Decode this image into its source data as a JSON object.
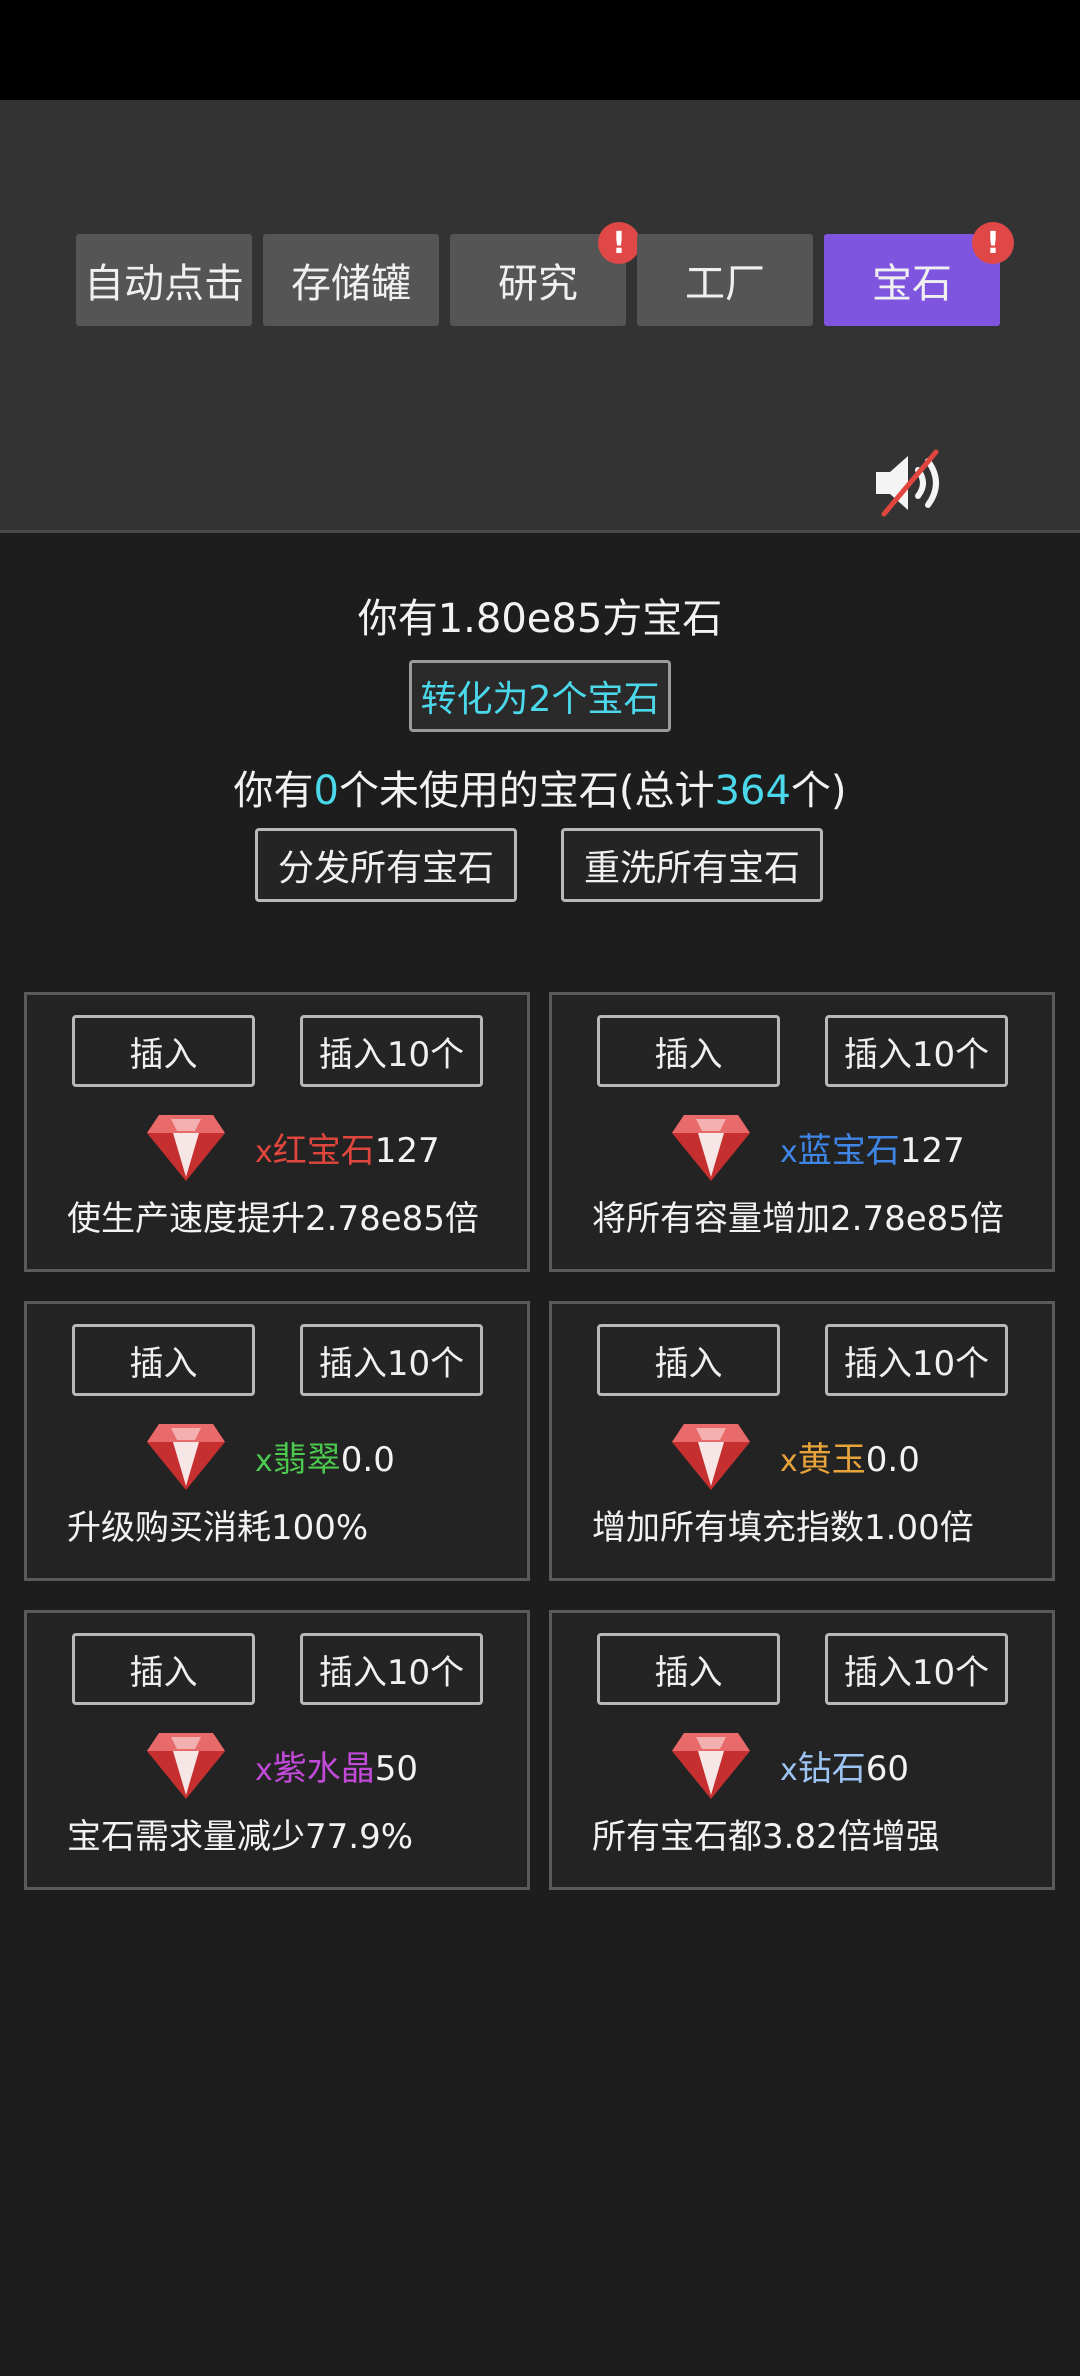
{
  "tabs": [
    {
      "label": "自动点击",
      "active": false,
      "alert": false
    },
    {
      "label": "存储罐",
      "active": false,
      "alert": false
    },
    {
      "label": "研究",
      "active": false,
      "alert": true
    },
    {
      "label": "工厂",
      "active": false,
      "alert": false
    },
    {
      "label": "宝石",
      "active": true,
      "alert": true
    }
  ],
  "alert_glyph": "!",
  "sound": {
    "icon": "sound-muted-icon"
  },
  "main": {
    "cubes_text": "你有1.80e85方宝石",
    "convert_button": "转化为2个宝石",
    "unused_prefix": "你有",
    "unused_count": "0",
    "unused_mid": "个未使用的宝石(总计",
    "total_count": "364",
    "unused_suffix": "个)",
    "distribute_button": "分发所有宝石",
    "reroll_button": "重洗所有宝石"
  },
  "colors": {
    "accent": "#7f55e0",
    "cyan": "#4ad8ea",
    "ruby": "#e0463e",
    "sapphire": "#3f86e8",
    "emerald": "#4cc94e",
    "topaz": "#e8a43a",
    "amethyst": "#c24ad8",
    "diamond": "#9ec4f4"
  },
  "cards": [
    {
      "insert": "插入",
      "insert10": "插入10个",
      "x": "x",
      "name": "红宝石",
      "value": "127",
      "desc": "使生产速度提升2.78e85倍",
      "color": "#e0463e"
    },
    {
      "insert": "插入",
      "insert10": "插入10个",
      "x": "x",
      "name": "蓝宝石",
      "value": "127",
      "desc": "将所有容量增加2.78e85倍",
      "color": "#3f86e8"
    },
    {
      "insert": "插入",
      "insert10": "插入10个",
      "x": "x",
      "name": "翡翠",
      "value": "0.0",
      "desc": "升级购买消耗100%",
      "color": "#4cc94e"
    },
    {
      "insert": "插入",
      "insert10": "插入10个",
      "x": "x",
      "name": "黄玉",
      "value": "0.0",
      "desc": "增加所有填充指数1.00倍",
      "color": "#e8a43a"
    },
    {
      "insert": "插入",
      "insert10": "插入10个",
      "x": "x",
      "name": "紫水晶",
      "value": "50",
      "desc": "宝石需求量减少77.9%",
      "color": "#c24ad8"
    },
    {
      "insert": "插入",
      "insert10": "插入10个",
      "x": "x",
      "name": "钻石",
      "value": "60",
      "desc": "所有宝石都3.82倍增强",
      "color": "#9ec4f4"
    }
  ]
}
